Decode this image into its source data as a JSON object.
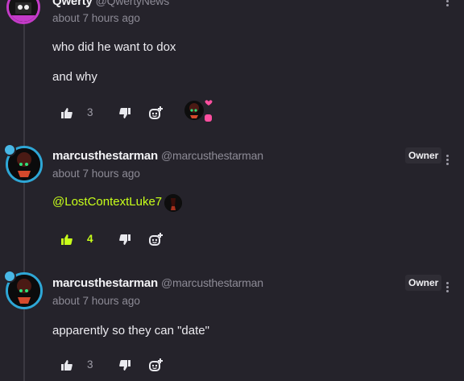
{
  "comments": [
    {
      "author": "Qwerty",
      "handle": "@QwertyNews",
      "timestamp": "about 7 hours ago",
      "lines": [
        "who did he want to dox",
        "and why"
      ],
      "likes": "3",
      "liked": false
    },
    {
      "author": "marcusthestarman",
      "handle": "@marcusthestarman",
      "badge": "Owner",
      "timestamp": "about 7 hours ago",
      "mention": "@LostContextLuke7",
      "likes": "4",
      "liked": true
    },
    {
      "author": "marcusthestarman",
      "handle": "@marcusthestarman",
      "badge": "Owner",
      "timestamp": "about 7 hours ago",
      "lines": [
        "apparently so they can \"date\""
      ],
      "likes": "3",
      "liked": false
    }
  ],
  "colors": {
    "background": "#25232b",
    "accent": "#c8ff1a",
    "muted": "#8d8b96",
    "qwerty_ring": "#c43bc8",
    "owner_ring": "#2ea7d6"
  },
  "icons": [
    "thumbs-up-icon",
    "thumbs-down-icon",
    "reply-add-icon",
    "kebab-menu-icon",
    "heart-icon"
  ]
}
